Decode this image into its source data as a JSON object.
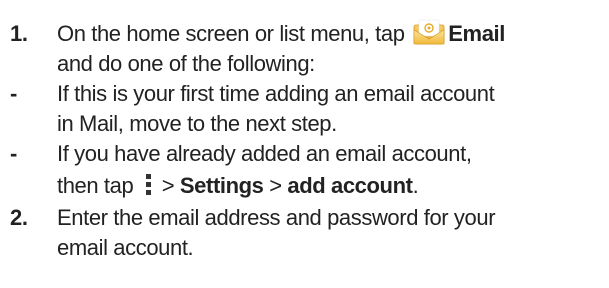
{
  "steps": [
    {
      "marker": "1.",
      "text_before_icon": "On the home screen or list menu, tap ",
      "icon": "email-app-icon",
      "app_name": "Email",
      "continuation": "and do one of the following:"
    },
    {
      "marker": "2.",
      "line1": "Enter the email address and password for your",
      "line2": "email account."
    }
  ],
  "bullets": [
    {
      "marker": "-",
      "line1": "If this is your first time adding an email account",
      "line2": "in Mail, move to the next step."
    },
    {
      "marker": "-",
      "line1": "If you have already added an email account,",
      "line2_prefix": "then tap ",
      "icon": "more-options-icon",
      "sep1": " > ",
      "settings": "Settings",
      "sep2": " > ",
      "add_account": "add account",
      "end": "."
    }
  ],
  "colors": {
    "text": "#222222",
    "email_icon_gold": "#f0b93a"
  }
}
